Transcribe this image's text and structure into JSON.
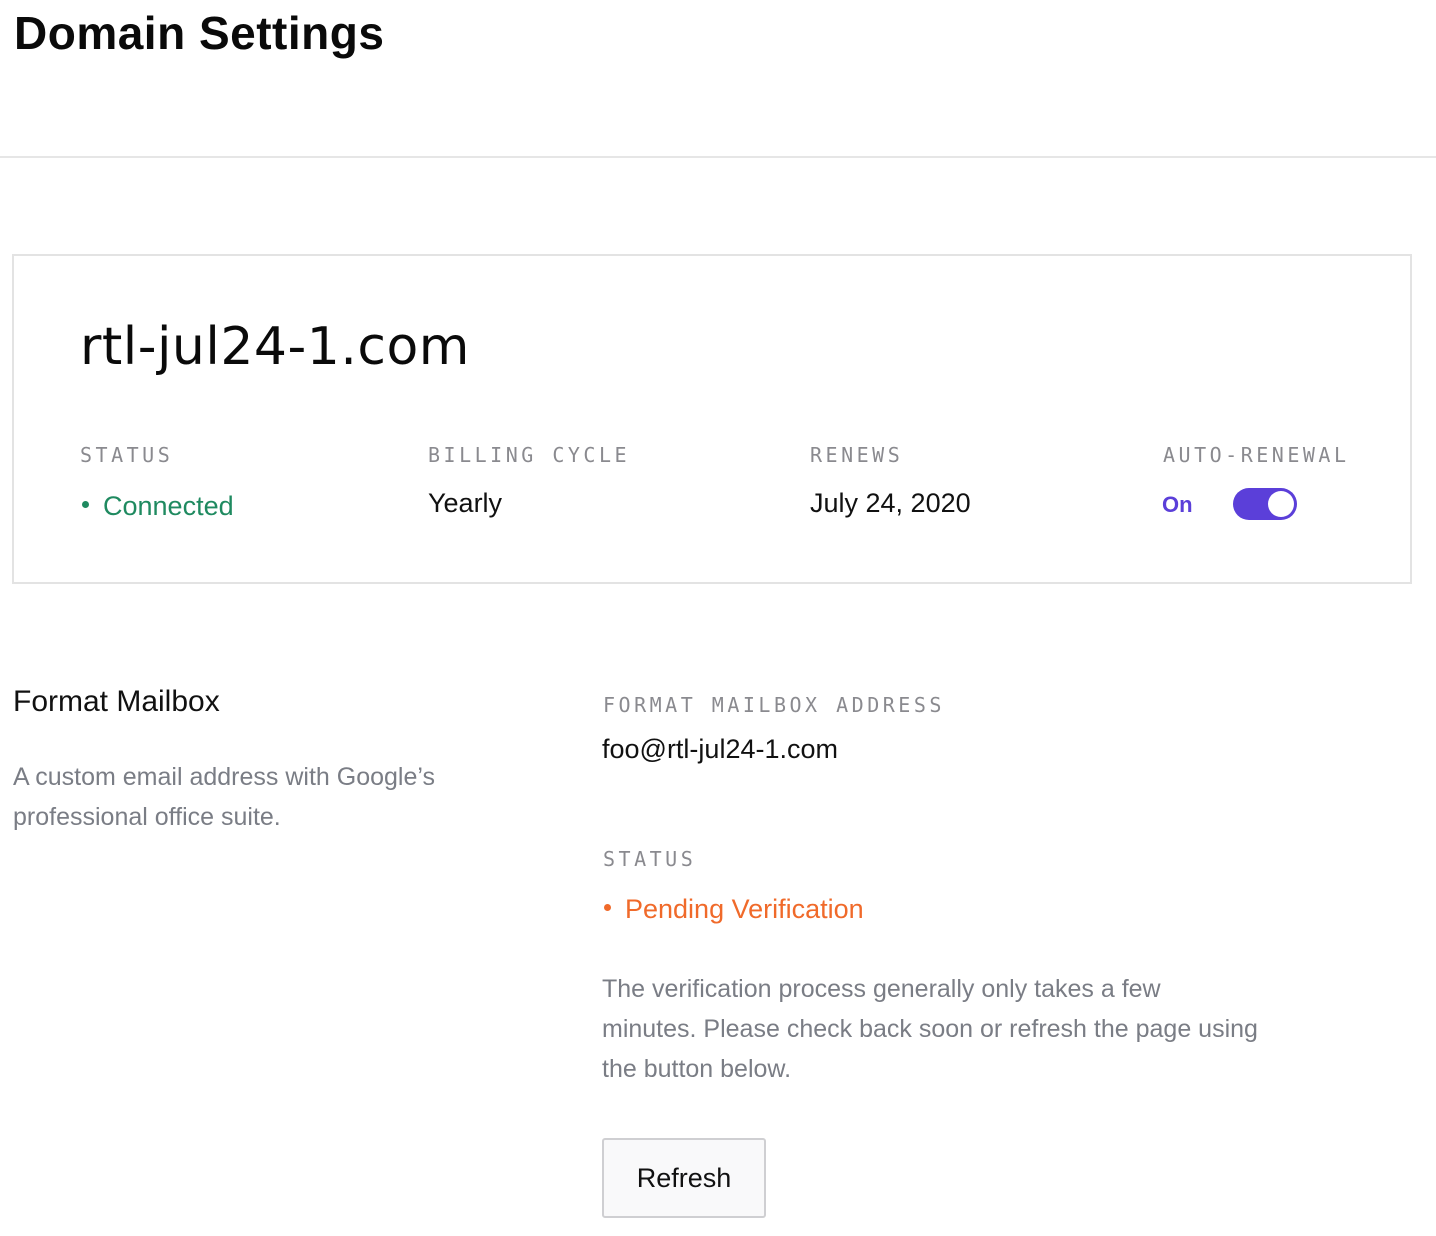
{
  "page": {
    "title": "Domain Settings"
  },
  "domain_card": {
    "domain_name": "rtl-jul24-1.com",
    "status": {
      "label": "STATUS",
      "value": "Connected",
      "color": "#1f8a60"
    },
    "billing_cycle": {
      "label": "BILLING CYCLE",
      "value": "Yearly"
    },
    "renews": {
      "label": "RENEWS",
      "value": "July 24, 2020"
    },
    "auto_renewal": {
      "label": "AUTO-RENEWAL",
      "state_text": "On",
      "enabled": true,
      "accent_color": "#5b3fd9"
    }
  },
  "mailbox": {
    "title": "Format Mailbox",
    "description": "A custom email address with Google’s professional office suite.",
    "address_label": "FORMAT MAILBOX ADDRESS",
    "address_value": "foo@rtl-jul24-1.com",
    "status_label": "STATUS",
    "status_value": "Pending Verification",
    "status_color": "#f06a2a",
    "help_text": "The verification process generally only takes a few minutes. Please check back soon or refresh the page using the button below.",
    "refresh_label": "Refresh"
  }
}
